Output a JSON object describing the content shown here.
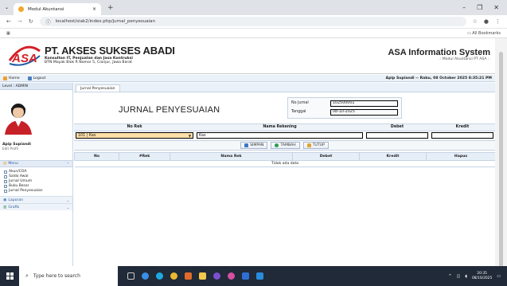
{
  "browser": {
    "tab_title": "Modul Akuntansi",
    "url": "localhost/siak2/index.php/jurnal_penyesuaian",
    "bookmarks_label": "All Bookmarks"
  },
  "header": {
    "logo_text": "ASA",
    "company_name": "PT. AKSES SUKSES ABADI",
    "company_tagline": "Konsultan IT, Penjualan dan Jasa Kontruksi",
    "company_address": "BTN Mayak Blok R Nomor 5, Cianjur, Jawa Barat",
    "system_title": "ASA Information System",
    "system_subtitle": ".: Modul Akuntansi PT ASA :."
  },
  "nav": {
    "home": "Home",
    "logout": "Logout",
    "user_info": "Apip Supiandi -- Rabu, 08 October 2025 8:35:21 PM"
  },
  "sidebar": {
    "level": "Level : ADMIN",
    "user_name": "Apip Supiandi",
    "edit_profile": "Edit Profil",
    "menu_header": "Menu",
    "items": [
      {
        "label": "Akun/COA"
      },
      {
        "label": "Saldo Awal"
      },
      {
        "label": "Jurnal Umum"
      },
      {
        "label": "Buku Besar"
      },
      {
        "label": "Jurnal Penyesuaian"
      }
    ],
    "laporan": "Laporan",
    "grafik": "Grafik"
  },
  "main": {
    "tab_label": "Jurnal Penyesuaian",
    "title": "JURNAL PENYESUAIAN",
    "no_jurnal_label": "No Jurnal",
    "no_jurnal_value": "102500001",
    "tanggal_label": "Tanggal",
    "tanggal_value": "08-10-2025",
    "entry_headers": {
      "no_rek": "No Rek",
      "nama_rekening": "Nama Rekening",
      "debet": "Debet",
      "kredit": "Kredit"
    },
    "entry": {
      "no_rek_selected": "101 | Kas",
      "nama_rekening": "Kas",
      "debet": "",
      "kredit": ""
    },
    "buttons": {
      "simpan": "SIMPAN",
      "tambah": "TAMBAH",
      "tutup": "TUTUP"
    },
    "list_headers": [
      "No",
      "#Rek",
      "Nama Rek",
      "Debet",
      "Kredit",
      "Hapus"
    ],
    "empty_message": "Tidak ada data"
  },
  "taskbar": {
    "search_placeholder": "Type here to search",
    "time": "20:35",
    "date": "08/10/2025"
  },
  "colors": {
    "accent_red": "#d42027",
    "accent_blue": "#1f5ca8",
    "select_bg": "#ffe0a8",
    "taskbar": "#202a38"
  }
}
